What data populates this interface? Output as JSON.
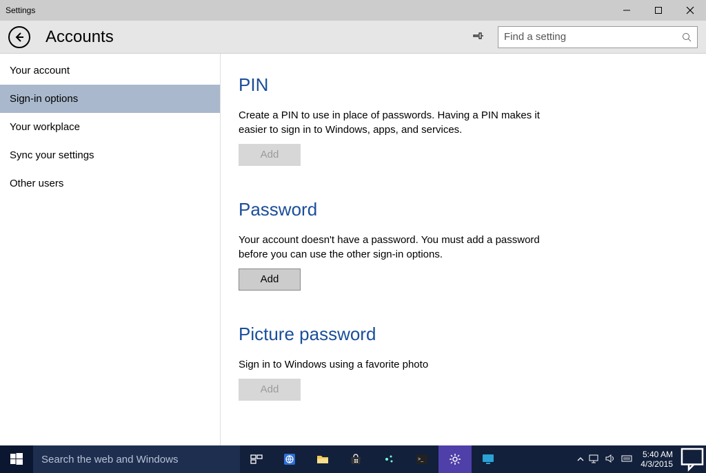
{
  "window": {
    "title": "Settings"
  },
  "header": {
    "title": "Accounts",
    "search_placeholder": "Find a setting"
  },
  "sidebar": {
    "items": [
      {
        "label": "Your account",
        "active": false
      },
      {
        "label": "Sign-in options",
        "active": true
      },
      {
        "label": "Your workplace",
        "active": false
      },
      {
        "label": "Sync your settings",
        "active": false
      },
      {
        "label": "Other users",
        "active": false
      }
    ]
  },
  "main": {
    "pin": {
      "title": "PIN",
      "desc": "Create a PIN to use in place of passwords. Having a PIN makes it easier to sign in to Windows, apps, and services.",
      "button": "Add"
    },
    "password": {
      "title": "Password",
      "desc": "Your account doesn't have a password. You must add a password before you can use the other sign-in options.",
      "button": "Add"
    },
    "picture": {
      "title": "Picture password",
      "desc": "Sign in to Windows using a favorite photo",
      "button": "Add"
    }
  },
  "taskbar": {
    "search_placeholder": "Search the web and Windows",
    "time": "5:40 AM",
    "date": "4/3/2015"
  }
}
